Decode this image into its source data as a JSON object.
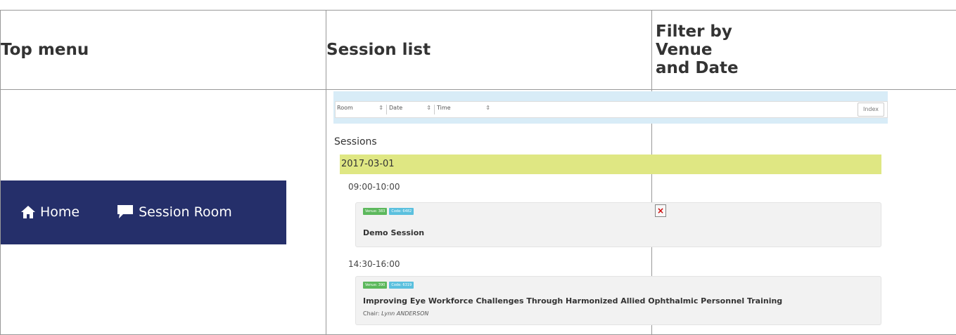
{
  "headers": {
    "top_menu": "Top menu",
    "session_list": "Session list",
    "filter_line1": "Filter by",
    "filter_line2": "Venue",
    "filter_line3": "and Date"
  },
  "top_menu": {
    "home_label": "Home",
    "session_room_label": "Session Room",
    "background": "#252f6a"
  },
  "session_list": {
    "filters": {
      "room": "Room",
      "date": "Date",
      "time": "Time",
      "index": "Index"
    },
    "sessions_title": "Sessions",
    "date": "2017-03-01",
    "slots": [
      {
        "time": "09:00-10:00",
        "venue_badge": "Venue: 383",
        "code_badge": "Code: 6482",
        "title": "Demo Session",
        "chair_label": "",
        "chair_name": ""
      },
      {
        "time": "14:30-16:00",
        "venue_badge": "Venue: 390",
        "code_badge": "Code: 6319",
        "title": "Improving Eye Workforce Challenges Through Harmonized Allied Ophthalmic Personnel Training",
        "chair_label": "Chair:",
        "chair_name": "Lynn ANDERSON"
      }
    ]
  },
  "filter_image": {
    "icon": "broken-image-icon",
    "glyph": "×"
  }
}
